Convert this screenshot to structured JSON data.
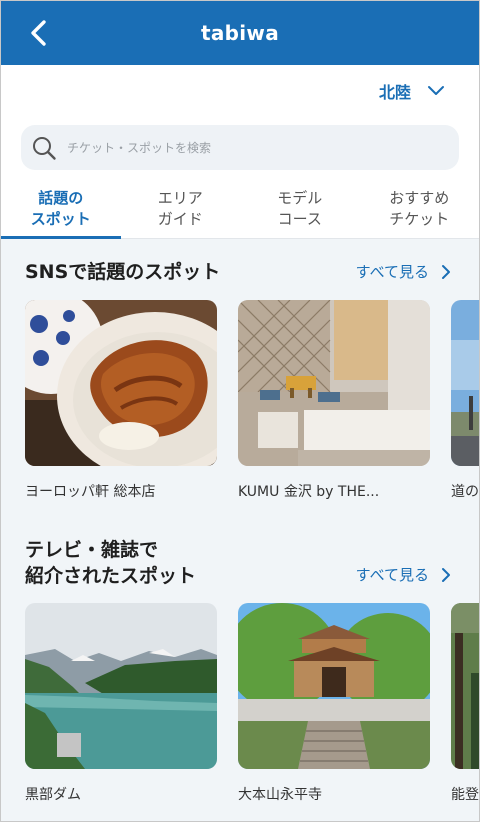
{
  "header": {
    "title": "tabiwa",
    "back_icon": "chevron-left-icon"
  },
  "region": {
    "label": "北陸",
    "icon": "chevron-down-icon"
  },
  "search": {
    "placeholder": "チケット・スポットを検索",
    "icon": "search-icon"
  },
  "tabs": [
    {
      "line1": "話題の",
      "line2": "スポット",
      "active": true
    },
    {
      "line1": "エリア",
      "line2": "ガイド",
      "active": false
    },
    {
      "line1": "モデル",
      "line2": "コース",
      "active": false
    },
    {
      "line1": "おすすめ",
      "line2": "チケット",
      "active": false
    }
  ],
  "sections": [
    {
      "title_line1": "SNSで話題のスポット",
      "see_all": "すべて見る",
      "cards": [
        {
          "label": "ヨーロッパ軒 総本店"
        },
        {
          "label": "KUMU 金沢 by THE..."
        },
        {
          "label": "道の"
        }
      ]
    },
    {
      "title_line1": "テレビ・雑誌で",
      "title_line2": "紹介されたスポット",
      "see_all": "すべて見る",
      "cards": [
        {
          "label": "黒部ダム"
        },
        {
          "label": "大本山永平寺"
        },
        {
          "label": "能登"
        }
      ]
    }
  ],
  "colors": {
    "accent": "#1a6eb5",
    "background": "#f1f5f8"
  }
}
